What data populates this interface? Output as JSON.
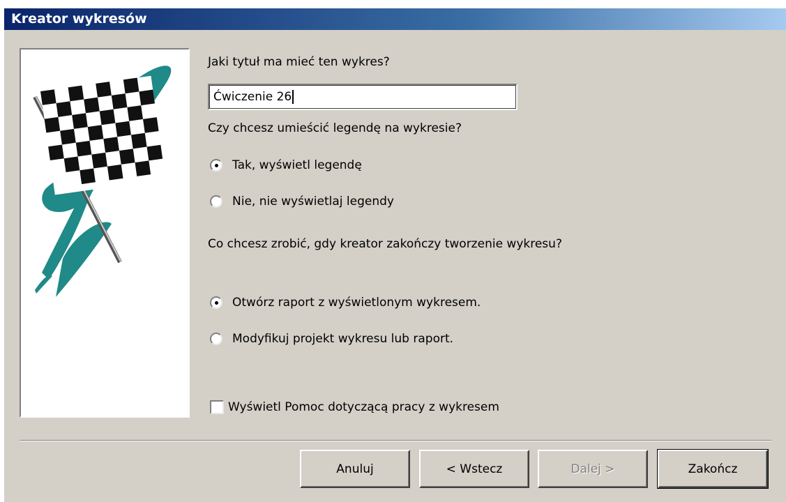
{
  "window": {
    "title": "Kreator wykresów"
  },
  "title_question": "Jaki tytuł ma mieć ten wykres?",
  "title_input": {
    "value": "Ćwiczenie 26"
  },
  "legend_question": "Czy chcesz umieścić legendę na wykresie?",
  "legend_options": [
    {
      "label": "Tak, wyświetl legendę",
      "checked": true
    },
    {
      "label": "Nie, nie wyświetlaj legendy",
      "checked": false
    }
  ],
  "after_question": "Co chcesz zrobić, gdy kreator zakończy tworzenie wykresu?",
  "after_options": [
    {
      "label": "Otwórz raport z wyświetlonym wykresem.",
      "checked": true
    },
    {
      "label": "Modyfikuj projekt wykresu lub raport.",
      "checked": false
    }
  ],
  "help_checkbox": {
    "label": "Wyświetl Pomoc dotyczącą pracy z wykresem",
    "checked": false
  },
  "buttons": {
    "cancel": "Anuluj",
    "back": "< Wstecz",
    "next": "Dalej >",
    "finish": "Zakończ"
  },
  "colors": {
    "titlebar_start": "#0a246a",
    "dialog_bg": "#d4d0c8",
    "flag_teal": "#1f8a87"
  },
  "icons": {
    "wizard_image": "checkered-flag-icon"
  }
}
